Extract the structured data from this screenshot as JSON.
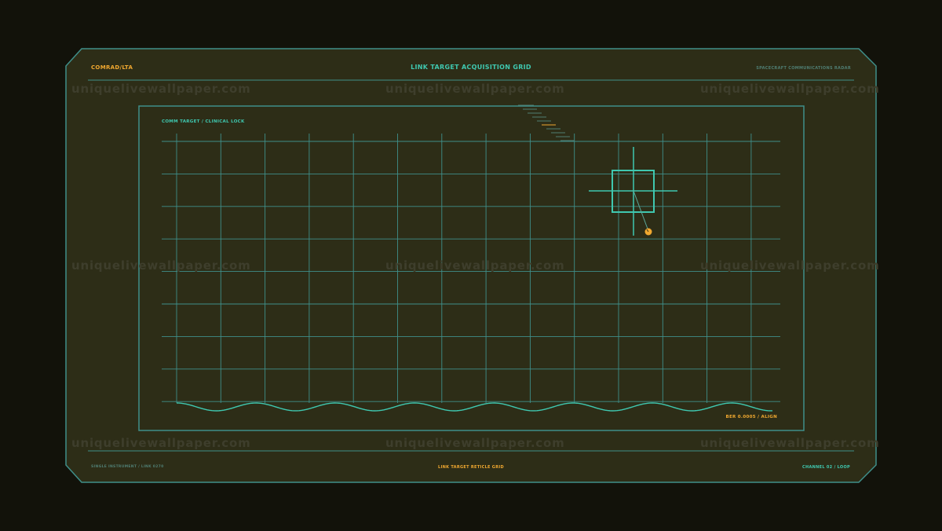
{
  "header": {
    "left_code": "COMRAD/LTA",
    "title": "LINK TARGET ACQUISITION GRID",
    "right_label": "SPACECRAFT COMMUNICATIONS RADAR"
  },
  "panel": {
    "label": "COMM TARGET / CLINICAL LOCK",
    "readout": "BER 0.0005 / ALIGN"
  },
  "footer": {
    "left": "SINGLE INSTRUMENT / LINK 0270",
    "center": "LINK TARGET RETICLE GRID",
    "right": "CHANNEL 02 / LOOP"
  },
  "watermark": {
    "text": "uniquelivewallpaper.com"
  },
  "colors": {
    "background": "#12120a",
    "panel": "#2d2d17",
    "line": "#3f8f8a",
    "accent_cyan": "#3fc8b0",
    "accent_orange": "#f0a830",
    "muted_text": "#4f7d72"
  },
  "icons": {
    "reticle": "crosshair-target-icon",
    "target_dot": "target-marker-icon"
  }
}
